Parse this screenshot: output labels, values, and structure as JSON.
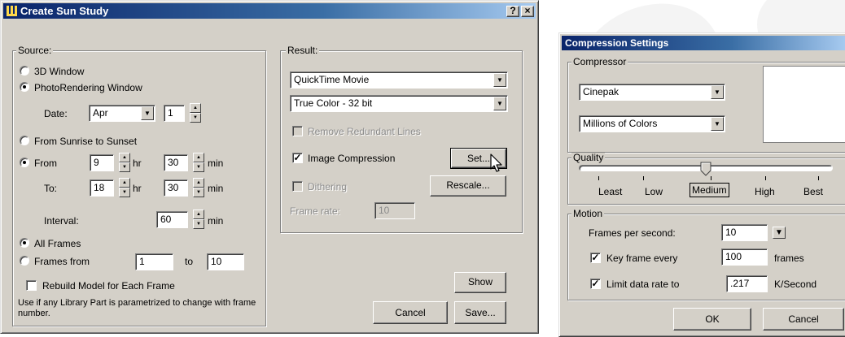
{
  "sun_study": {
    "title": "Create Sun Study",
    "help_button": "?",
    "close_button": "×",
    "source": {
      "label": "Source:",
      "opt_3d": "3D Window",
      "opt_photo": "PhotoRendering Window",
      "date_label": "Date:",
      "date_month": "Apr",
      "date_day": "1",
      "opt_sunrise": "From Sunrise to Sunset",
      "opt_from": "From",
      "from_hr": "9",
      "from_min": "30",
      "to_label": "To:",
      "to_hr": "18",
      "to_min": "30",
      "unit_hr": "hr",
      "unit_min": "min",
      "interval_label": "Interval:",
      "interval_value": "60",
      "opt_all_frames": "All Frames",
      "opt_frames_from": "Frames from",
      "frames_from": "1",
      "frames_to_label": "to",
      "frames_to": "10",
      "rebuild_label": "Rebuild Model for Each Frame",
      "note": "Use if any Library Part is parametrized to change with frame number."
    },
    "result": {
      "label": "Result:",
      "format": "QuickTime Movie",
      "color": "True Color - 32 bit",
      "remove_redundant": "Remove Redundant Lines",
      "image_compression": "Image Compression",
      "set_button": "Set...",
      "dithering": "Dithering",
      "rescale_button": "Rescale...",
      "frame_rate_label": "Frame rate:",
      "frame_rate_value": "10"
    },
    "show_button": "Show",
    "cancel_button": "Cancel",
    "save_button": "Save..."
  },
  "compression": {
    "title": "Compression Settings",
    "compressor_label": "Compressor",
    "compressor": "Cinepak",
    "colors": "Millions of Colors",
    "quality_label": "Quality",
    "quality_marks": [
      "Least",
      "Low",
      "Medium",
      "High",
      "Best"
    ],
    "quality_level": 0.5,
    "motion_label": "Motion",
    "fps_label": "Frames per second:",
    "fps_value": "10",
    "keyframe_label": "Key frame every",
    "keyframe_value": "100",
    "keyframe_unit": "frames",
    "datarate_label": "Limit data rate to",
    "datarate_value": ".217",
    "datarate_unit": "K/Second",
    "ok_button": "OK",
    "cancel_button": "Cancel"
  },
  "colors": {
    "title_start": "#0a246a",
    "title_end": "#a6caf0",
    "dialog_face": "#d4d0c8"
  }
}
